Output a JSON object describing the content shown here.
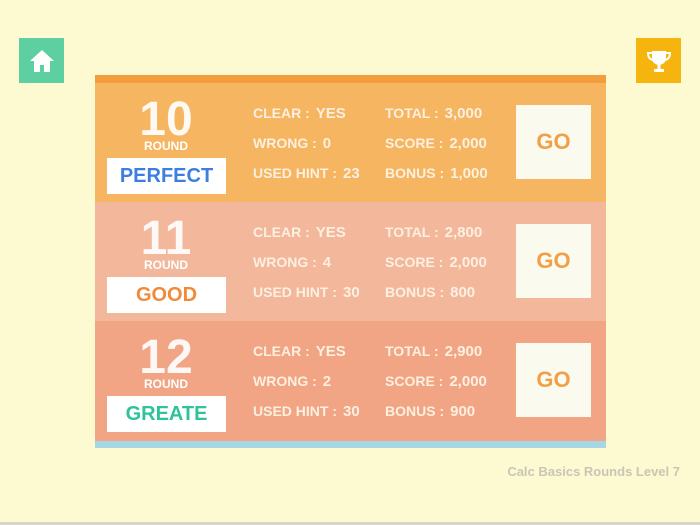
{
  "colors": {
    "background": "#fdf9d1",
    "home": "#5ecfa0",
    "trophy": "#f6b40e",
    "row_1": "#f6b560",
    "row_2": "#f3b79c",
    "row_3": "#f2a584",
    "go_text": "#f0a048"
  },
  "header": {
    "home_icon": "home-icon",
    "trophy_icon": "trophy-icon"
  },
  "rounds": [
    {
      "number": "10",
      "round_label": "ROUND",
      "grade": "PERFECT",
      "grade_color": "#3d7ee0",
      "clear_label": "CLEAR :",
      "clear": "YES",
      "wrong_label": "WRONG :",
      "wrong": "0",
      "hint_label": "USED HINT :",
      "hint": "23",
      "total_label": "TOTAL :",
      "total": "3,000",
      "score_label": "SCORE :",
      "score": "2,000",
      "bonus_label": "BONUS :",
      "bonus": "1,000",
      "go": "GO"
    },
    {
      "number": "11",
      "round_label": "ROUND",
      "grade": "GOOD",
      "grade_color": "#f08a3c",
      "clear_label": "CLEAR :",
      "clear": "YES",
      "wrong_label": "WRONG :",
      "wrong": "4",
      "hint_label": "USED HINT :",
      "hint": "30",
      "total_label": "TOTAL :",
      "total": "2,800",
      "score_label": "SCORE :",
      "score": "2,000",
      "bonus_label": "BONUS :",
      "bonus": "800",
      "go": "GO"
    },
    {
      "number": "12",
      "round_label": "ROUND",
      "grade": "GREATE",
      "grade_color": "#2fc39a",
      "clear_label": "CLEAR :",
      "clear": "YES",
      "wrong_label": "WRONG :",
      "wrong": "2",
      "hint_label": "USED HINT :",
      "hint": "30",
      "total_label": "TOTAL :",
      "total": "2,900",
      "score_label": "SCORE :",
      "score": "2,000",
      "bonus_label": "BONUS :",
      "bonus": "900",
      "go": "GO"
    }
  ],
  "footer": "Calc Basics Rounds Level 7"
}
